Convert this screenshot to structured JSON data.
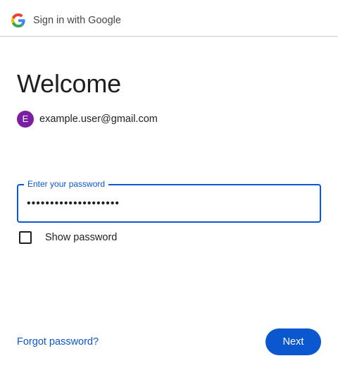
{
  "header": {
    "title": "Sign in with Google",
    "logo_icon": "google-g-logo-icon"
  },
  "heading": "Welcome",
  "account": {
    "avatar_initial": "E",
    "avatar_color": "#7b1fa2",
    "email": "example.user@gmail.com"
  },
  "password_field": {
    "label": "Enter your password",
    "value": "••••••••••••••••••••",
    "focused": true,
    "accent_color": "#0b57d0"
  },
  "show_password": {
    "label": "Show password",
    "checked": false
  },
  "footer": {
    "forgot_label": "Forgot password?",
    "next_label": "Next"
  },
  "colors": {
    "primary": "#0b57d0",
    "text": "#1f1f1f",
    "divider": "#c7c7c7"
  }
}
